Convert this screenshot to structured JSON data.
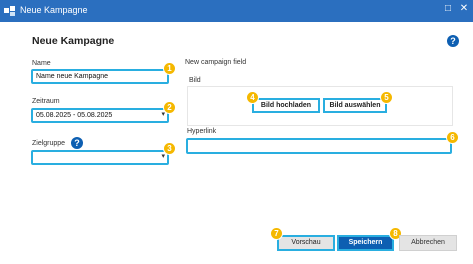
{
  "window": {
    "title": "Neue Kampagne",
    "maximize_glyph": "□",
    "close_glyph": "✕"
  },
  "dialog": {
    "heading": "Neue Kampagne",
    "help_glyph": "?"
  },
  "form": {
    "name_label": "Name",
    "name_value": "Name neue Kampagne",
    "period_label": "Zeitraum",
    "period_value": "05.08.2025 - 05.08.2025",
    "target_label": "Zielgruppe",
    "target_value": "",
    "custom_field_label": "New campaign field",
    "image_label": "Bild",
    "upload_button": "Bild hochladen",
    "select_button": "Bild auswählen",
    "hyperlink_label": "Hyperlink",
    "hyperlink_value": ""
  },
  "footer": {
    "preview_button": "Vorschau",
    "save_button": "Speichern",
    "cancel_button": "Abbrechen"
  },
  "badges": [
    "1",
    "2",
    "3",
    "4",
    "5",
    "6",
    "7",
    "8"
  ],
  "colors": {
    "titlebar": "#2b6fbf",
    "highlight": "#29aee0",
    "badge": "#f5b800",
    "primary": "#0d5fb2"
  }
}
